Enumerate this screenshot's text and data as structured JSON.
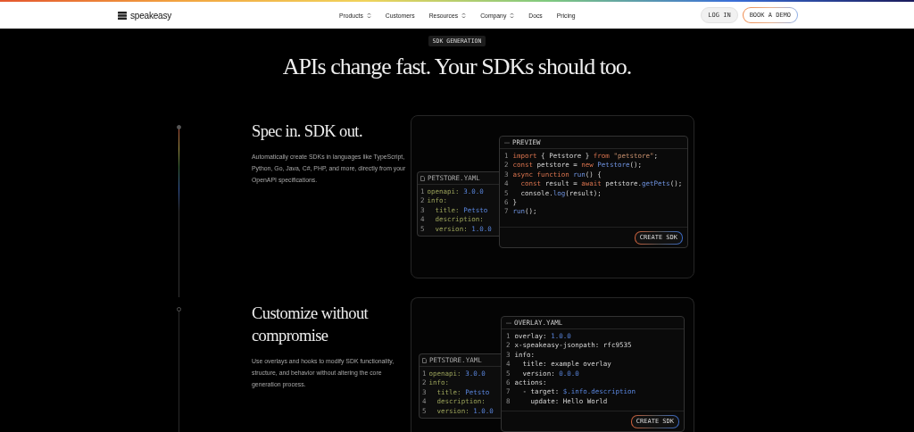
{
  "nav": {
    "logo": "speakeasy",
    "links": [
      {
        "label": "Products",
        "dropdown": true
      },
      {
        "label": "Customers",
        "dropdown": false
      },
      {
        "label": "Resources",
        "dropdown": true
      },
      {
        "label": "Company",
        "dropdown": true
      },
      {
        "label": "Docs",
        "dropdown": false
      },
      {
        "label": "Pricing",
        "dropdown": false
      }
    ],
    "login": "LOG IN",
    "cta": "BOOK A DEMO"
  },
  "hero": {
    "badge": "SDK GENERATION",
    "headline": "APIs change fast. Your SDKs should too."
  },
  "features": [
    {
      "title": "Spec in. SDK out.",
      "text": "Automatically create SDKs in languages like TypeScript, Python, Go, Java, C#, PHP, and more, directly from your OpenAPI specifications.",
      "active": true,
      "card": {
        "back_panel": {
          "title": "PETSTORE.YAML",
          "lines": [
            {
              "n": "1",
              "tokens": [
                {
                  "t": "openapi:",
                  "kind": "key"
                },
                {
                  "t": " 3.0.0",
                  "kind": "num"
                }
              ]
            },
            {
              "n": "2",
              "tokens": [
                {
                  "t": "info:",
                  "kind": "key"
                }
              ]
            },
            {
              "n": "3",
              "tokens": [
                {
                  "t": "  title:",
                  "kind": "key"
                },
                {
                  "t": " Petsto",
                  "kind": "num"
                }
              ]
            },
            {
              "n": "4",
              "tokens": [
                {
                  "t": "  description:",
                  "kind": "key"
                }
              ]
            },
            {
              "n": "5",
              "tokens": [
                {
                  "t": "  version:",
                  "kind": "key"
                },
                {
                  "t": " 1.0.0",
                  "kind": "num"
                }
              ]
            }
          ]
        },
        "front_panel": {
          "title": "PREVIEW",
          "button": "CREATE SDK",
          "lines": [
            {
              "n": "1",
              "tokens": [
                {
                  "t": "import",
                  "kind": "kw"
                },
                {
                  "t": " { Petstore } ",
                  "kind": "plain"
                },
                {
                  "t": "from",
                  "kind": "kw"
                },
                {
                  "t": " \"petstore\"",
                  "kind": "str"
                },
                {
                  "t": ";",
                  "kind": "plain"
                }
              ]
            },
            {
              "n": "2",
              "tokens": [
                {
                  "t": "const",
                  "kind": "kw"
                },
                {
                  "t": " petstore = ",
                  "kind": "plain"
                },
                {
                  "t": "new",
                  "kind": "kw"
                },
                {
                  "t": " Petstore",
                  "kind": "fn"
                },
                {
                  "t": "();",
                  "kind": "plain"
                }
              ]
            },
            {
              "n": "3",
              "tokens": [
                {
                  "t": "async function",
                  "kind": "kw"
                },
                {
                  "t": " run",
                  "kind": "fn"
                },
                {
                  "t": "() {",
                  "kind": "plain"
                }
              ]
            },
            {
              "n": "4",
              "tokens": [
                {
                  "t": "  const",
                  "kind": "kw"
                },
                {
                  "t": " result = ",
                  "kind": "plain"
                },
                {
                  "t": "await",
                  "kind": "kw"
                },
                {
                  "t": " petstore.",
                  "kind": "plain"
                },
                {
                  "t": "getPets",
                  "kind": "fn"
                },
                {
                  "t": "();",
                  "kind": "plain"
                }
              ]
            },
            {
              "n": "5",
              "tokens": [
                {
                  "t": "  console.",
                  "kind": "plain"
                },
                {
                  "t": "log",
                  "kind": "fn"
                },
                {
                  "t": "(result);",
                  "kind": "plain"
                }
              ]
            },
            {
              "n": "6",
              "tokens": [
                {
                  "t": "}",
                  "kind": "plain"
                }
              ]
            },
            {
              "n": "7",
              "tokens": [
                {
                  "t": "run",
                  "kind": "fn"
                },
                {
                  "t": "();",
                  "kind": "plain"
                }
              ]
            }
          ]
        }
      }
    },
    {
      "title": "Customize without compromise",
      "text": "Use overlays and hooks to modify SDK functionality, structure, and behavior without altering the core generation process.",
      "active": false,
      "card": {
        "back_panel": {
          "title": "PETSTORE.YAML",
          "lines": [
            {
              "n": "1",
              "tokens": [
                {
                  "t": "openapi:",
                  "kind": "key"
                },
                {
                  "t": " 3.0.0",
                  "kind": "num"
                }
              ]
            },
            {
              "n": "2",
              "tokens": [
                {
                  "t": "info:",
                  "kind": "key"
                }
              ]
            },
            {
              "n": "3",
              "tokens": [
                {
                  "t": "  title:",
                  "kind": "key"
                },
                {
                  "t": " Petsto",
                  "kind": "num"
                }
              ]
            },
            {
              "n": "4",
              "tokens": [
                {
                  "t": "  description:",
                  "kind": "key"
                }
              ]
            },
            {
              "n": "5",
              "tokens": [
                {
                  "t": "  version:",
                  "kind": "key"
                },
                {
                  "t": " 1.0.0",
                  "kind": "num"
                }
              ]
            }
          ]
        },
        "front_panel": {
          "title": "OVERLAY.YAML",
          "button": "CREATE SDK",
          "lines": [
            {
              "n": "1",
              "tokens": [
                {
                  "t": "overlay:",
                  "kind": "plain"
                },
                {
                  "t": " 1.0.0",
                  "kind": "num"
                }
              ]
            },
            {
              "n": "2",
              "tokens": [
                {
                  "t": "x-speakeasy-jsonpath: rfc9535",
                  "kind": "plain"
                }
              ]
            },
            {
              "n": "3",
              "tokens": [
                {
                  "t": "info:",
                  "kind": "plain"
                }
              ]
            },
            {
              "n": "4",
              "tokens": [
                {
                  "t": "  title: example overlay",
                  "kind": "plain"
                }
              ]
            },
            {
              "n": "5",
              "tokens": [
                {
                  "t": "  version:",
                  "kind": "plain"
                },
                {
                  "t": " 0.0.0",
                  "kind": "num"
                }
              ]
            },
            {
              "n": "6",
              "tokens": [
                {
                  "t": "actions:",
                  "kind": "plain"
                }
              ]
            },
            {
              "n": "7",
              "tokens": [
                {
                  "t": "  - target:",
                  "kind": "plain"
                },
                {
                  "t": " $.info.description",
                  "kind": "num"
                }
              ]
            },
            {
              "n": "8",
              "tokens": [
                {
                  "t": "    update: Hello World",
                  "kind": "plain"
                }
              ]
            }
          ]
        }
      }
    }
  ]
}
